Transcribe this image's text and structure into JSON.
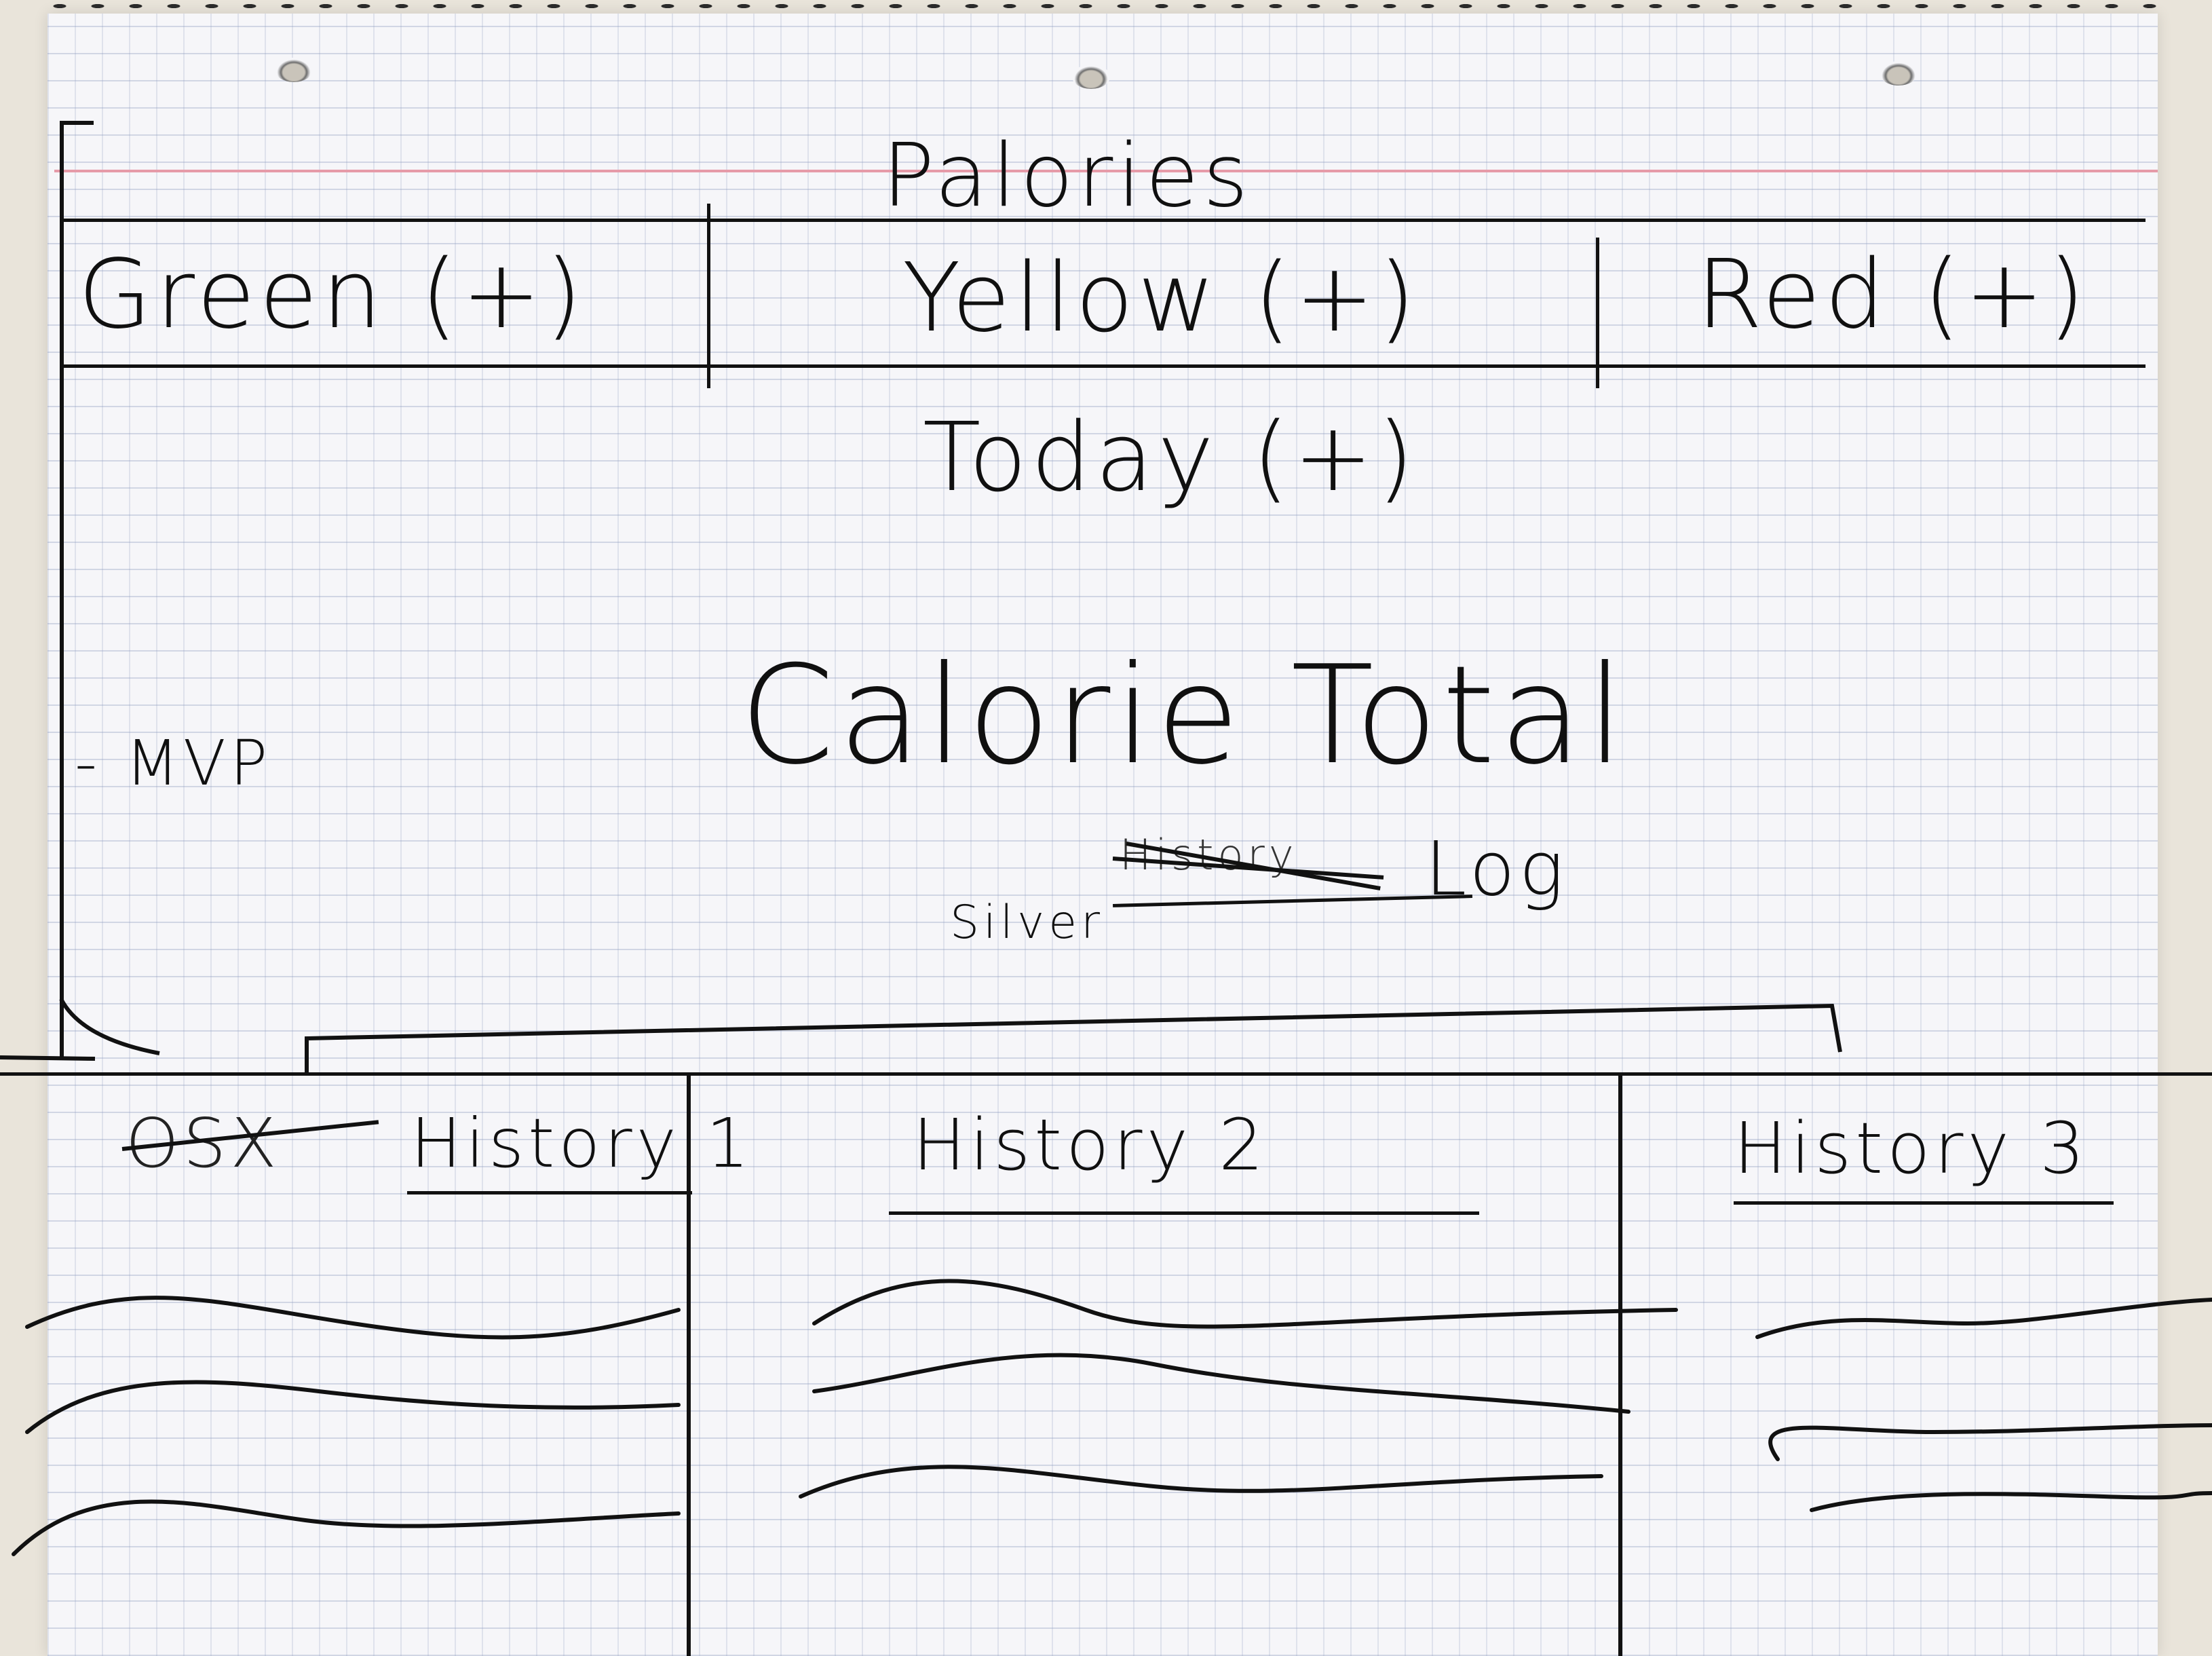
{
  "app": {
    "title": "Palories"
  },
  "rating_buttons": [
    {
      "label": "Green (+)"
    },
    {
      "label": "Yellow (+)"
    },
    {
      "label": "Red (+)"
    }
  ],
  "today_button": {
    "label": "Today (+)"
  },
  "note": {
    "label": "- MVP"
  },
  "main": {
    "calorie_total": "Calorie Total",
    "log_prefix_crossed": "History",
    "log_label": "Log",
    "log_insert": "Silver"
  },
  "history_tabs": [
    {
      "label": "History 1",
      "crossed_prefix": "OSX"
    },
    {
      "label": "History 2"
    },
    {
      "label": "History 3"
    }
  ]
}
